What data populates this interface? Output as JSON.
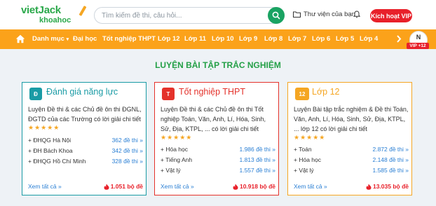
{
  "header": {
    "logo_main": "vietJack",
    "logo_sub": "khoahoc",
    "search_placeholder": "Tìm kiếm đề thi, câu hỏi...",
    "library_label": "Thư viện của bạn",
    "vip_button": "Kích hoạt VIP"
  },
  "nav": {
    "menu_label": "Danh mục",
    "items": [
      "Đại học",
      "Tốt nghiệp THPT",
      "Lớp 12",
      "Lớp 11",
      "Lớp 10",
      "Lớp 9",
      "Lớp 8",
      "Lớp 7",
      "Lớp 6",
      "Lớp 5",
      "Lớp 4"
    ],
    "avatar_initial": "N",
    "avatar_badge": "VIP +12"
  },
  "main": {
    "section_title": "LUYỆN BÀI TẬP TRẮC NGHIỆM",
    "cards": [
      {
        "icon_text": "Đ",
        "title": "Đánh giá năng lực",
        "desc": "Luyện Đề thi & các Chủ đề ôn thi ĐGNL, ĐGTD của các Trường có lời giải chi tiết",
        "stars": "★★★★★",
        "rows": [
          {
            "label": "+ ĐHQG Hà Nội",
            "count": "362 đề thi »"
          },
          {
            "label": "+ ĐH Bách Khoa",
            "count": "342 đề thi »"
          },
          {
            "label": "+ ĐHQG Hồ Chí Minh",
            "count": "328 đề thi »"
          }
        ],
        "see_all": "Xem tất cả »",
        "total": "1.051 bộ đề"
      },
      {
        "icon_text": "T",
        "title": "Tốt nghiệp THPT",
        "desc": "Luyện Đề thi & các Chủ đề ôn thi Tốt nghiệp Toán, Văn, Anh, Lí, Hóa, Sinh, Sử, Địa, KTPL, ... có lời giải chi tiết",
        "stars": "★★★★★",
        "rows": [
          {
            "label": "+ Hóa học",
            "count": "1.986 đề thi »"
          },
          {
            "label": "+ Tiếng Anh",
            "count": "1.813 đề thi »"
          },
          {
            "label": "+ Vật lý",
            "count": "1.557 đề thi »"
          }
        ],
        "see_all": "Xem tất cả »",
        "total": "10.918 bộ đề"
      },
      {
        "icon_text": "12",
        "title": "Lớp 12",
        "desc": "Luyện Bài tập trắc nghiệm & Đề thi Toán, Văn, Anh, Lí, Hóa, Sinh, Sử, Địa, KTPL, ... lớp 12 có lời giải chi tiết",
        "stars": "★★★★★",
        "rows": [
          {
            "label": "+ Toán",
            "count": "2.872 đề thi »"
          },
          {
            "label": "+ Hóa học",
            "count": "2.148 đề thi »"
          },
          {
            "label": "+ Vật lý",
            "count": "1.585 đề thi »"
          }
        ],
        "see_all": "Xem tất cả »",
        "total": "13.035 bộ đề"
      }
    ]
  },
  "colors": {
    "nav_bg": "#fba21a",
    "brand_green": "#24a047",
    "card1": "#1a9ba5",
    "card2": "#e4322b",
    "card3": "#f5a623",
    "link_blue": "#2a7fd4",
    "red": "#e8202a"
  }
}
